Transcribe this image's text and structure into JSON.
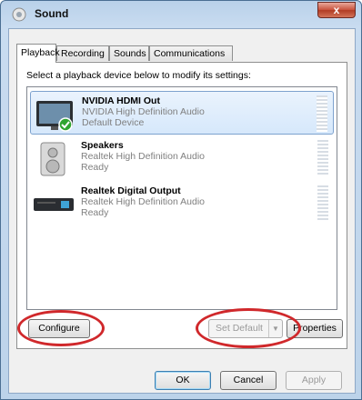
{
  "window": {
    "title": "Sound",
    "close_label": "x"
  },
  "tabs": [
    {
      "label": "Playback",
      "active": true
    },
    {
      "label": "Recording",
      "active": false
    },
    {
      "label": "Sounds",
      "active": false
    },
    {
      "label": "Communications",
      "active": false
    }
  ],
  "instruction": "Select a playback device below to modify its settings:",
  "devices": [
    {
      "name": "NVIDIA HDMI Out",
      "driver": "NVIDIA High Definition Audio",
      "status": "Default Device",
      "icon": "monitor-icon",
      "selected": true,
      "is_default": true
    },
    {
      "name": "Speakers",
      "driver": "Realtek High Definition Audio",
      "status": "Ready",
      "icon": "speaker-icon",
      "selected": false,
      "is_default": false
    },
    {
      "name": "Realtek Digital Output",
      "driver": "Realtek High Definition Audio",
      "status": "Ready",
      "icon": "digital-output-icon",
      "selected": false,
      "is_default": false
    }
  ],
  "buttons": {
    "configure": "Configure",
    "set_default": "Set Default",
    "properties": "Properties",
    "ok": "OK",
    "cancel": "Cancel",
    "apply": "Apply"
  },
  "colors": {
    "highlight": "#d0282b",
    "selected_row": "#d6e8fb",
    "check": "#2fa52f"
  }
}
